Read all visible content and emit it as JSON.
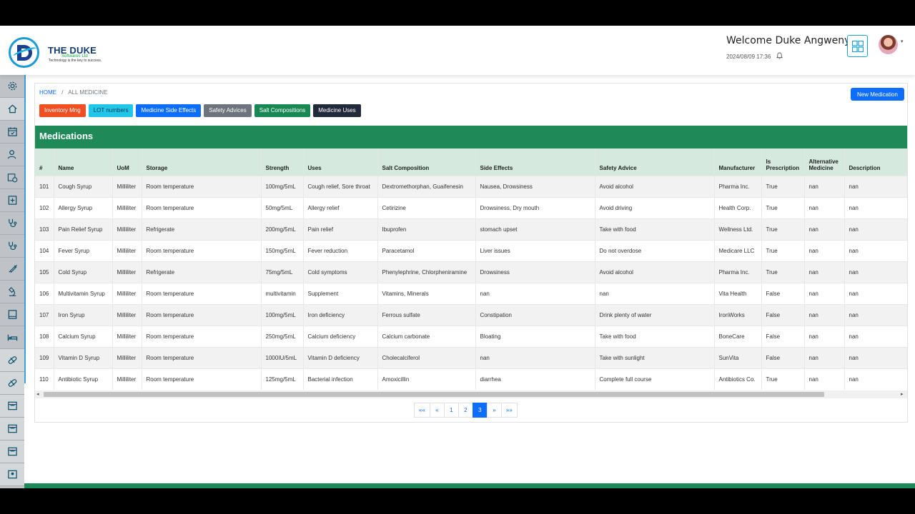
{
  "brand": {
    "name": "THE DUKE",
    "sub": "Softwares Ltd",
    "tagline": "Technology is the key to success."
  },
  "header": {
    "welcome": "Welcome Duke Angwenyi!",
    "datetime": "2024/08/09 17:36"
  },
  "breadcrumb": {
    "home": "HOME",
    "sep": "/",
    "current": "ALL MEDICINE"
  },
  "new_button": "New Medication",
  "pills": [
    {
      "label": "Inventory Mng",
      "color": "#f04e23"
    },
    {
      "label": "LOT numbers",
      "color": "#1fc6e8"
    },
    {
      "label": "Medicine Side Effects",
      "color": "#0d6efd"
    },
    {
      "label": "Safety Advices",
      "color": "#6c757d"
    },
    {
      "label": "Salt Compositions",
      "color": "#198754"
    },
    {
      "label": "Medicine Uses",
      "color": "#212a3a"
    }
  ],
  "panel_title": "Medications",
  "table": {
    "columns": [
      "#",
      "Name",
      "UoM",
      "Storage",
      "Strength",
      "Uses",
      "Salt Composition",
      "Side Effects",
      "Safety Advice",
      "Manufacturer",
      "Is Prescription",
      "Alternative Medicine",
      "Description"
    ],
    "rows": [
      [
        "101",
        "Cough Syrup",
        "Milliliter",
        "Room temperature",
        "100mg/5mL",
        "Cough relief, Sore throat",
        "Dextromethorphan, Guaifenesin",
        "Nausea, Drowsiness",
        "Avoid alcohol",
        "Pharma Inc.",
        "True",
        "nan",
        "nan"
      ],
      [
        "102",
        "Allergy Syrup",
        "Milliliter",
        "Room temperature",
        "50mg/5mL",
        "Allergy relief",
        "Cetirizine",
        "Drowsiness, Dry mouth",
        "Avoid driving",
        "Health Corp.",
        "True",
        "nan",
        "nan"
      ],
      [
        "103",
        "Pain Relief Syrup",
        "Milliliter",
        "Refrigerate",
        "200mg/5mL",
        "Pain relief",
        "Ibuprofen",
        "stomach upset",
        "Take with food",
        "Wellness Ltd.",
        "True",
        "nan",
        "nan"
      ],
      [
        "104",
        "Fever Syrup",
        "Milliliter",
        "Room temperature",
        "150mg/5mL",
        "Fever reduction",
        "Paracetamol",
        "Liver issues",
        "Do not overdose",
        "Medicare LLC",
        "True",
        "nan",
        "nan"
      ],
      [
        "105",
        "Cold Syrup",
        "Milliliter",
        "Refrigerate",
        "75mg/5mL",
        "Cold symptoms",
        "Phenylephrine, Chlorpheniramine",
        "Drowsiness",
        "Avoid alcohol",
        "Pharma Inc.",
        "True",
        "nan",
        "nan"
      ],
      [
        "106",
        "Multivitamin Syrup",
        "Milliliter",
        "Room temperature",
        "multivitamin",
        "Supplement",
        "Vitamins, Minerals",
        "nan",
        "nan",
        "Vita Health",
        "False",
        "nan",
        "nan"
      ],
      [
        "107",
        "Iron Syrup",
        "Milliliter",
        "Room temperature",
        "100mg/5mL",
        "Iron deficiency",
        "Ferrous sulfate",
        "Constipation",
        "Drink plenty of water",
        "IronWorks",
        "False",
        "nan",
        "nan"
      ],
      [
        "108",
        "Calcium Syrup",
        "Milliliter",
        "Room temperature",
        "250mg/5mL",
        "Calcium deficiency",
        "Calcium carbonate",
        "Bloating",
        "Take with food",
        "BoneCare",
        "False",
        "nan",
        "nan"
      ],
      [
        "109",
        "Vitamin D Syrup",
        "Milliliter",
        "Room temperature",
        "1000IU/5mL",
        "Vitamin D deficiency",
        "Cholecalciferol",
        "nan",
        "Take with sunlight",
        "SunVita",
        "False",
        "nan",
        "nan"
      ],
      [
        "110",
        "Antibiotic Syrup",
        "Milliliter",
        "Room temperature",
        "125mg/5mL",
        "Bacterial infection",
        "Amoxicillin",
        "diarrhea",
        "Complete full course",
        "Antibiotics Co.",
        "True",
        "nan",
        "nan"
      ]
    ]
  },
  "pagination": {
    "first": "««",
    "prev": "«",
    "pages": [
      "1",
      "2",
      "3"
    ],
    "active": "3",
    "next": "»",
    "last": "»»"
  },
  "sidebar_icons": [
    "gear-icon",
    "home-icon",
    "calendar-icon",
    "user-icon",
    "calendar-clock-icon",
    "plus-square-icon",
    "stethoscope-icon",
    "stethoscope-icon",
    "syringe-icon",
    "microscope-icon",
    "book-icon",
    "bed-icon",
    "pill-icon",
    "pill-icon",
    "store-icon",
    "store-icon",
    "store-icon",
    "id-card-icon"
  ]
}
